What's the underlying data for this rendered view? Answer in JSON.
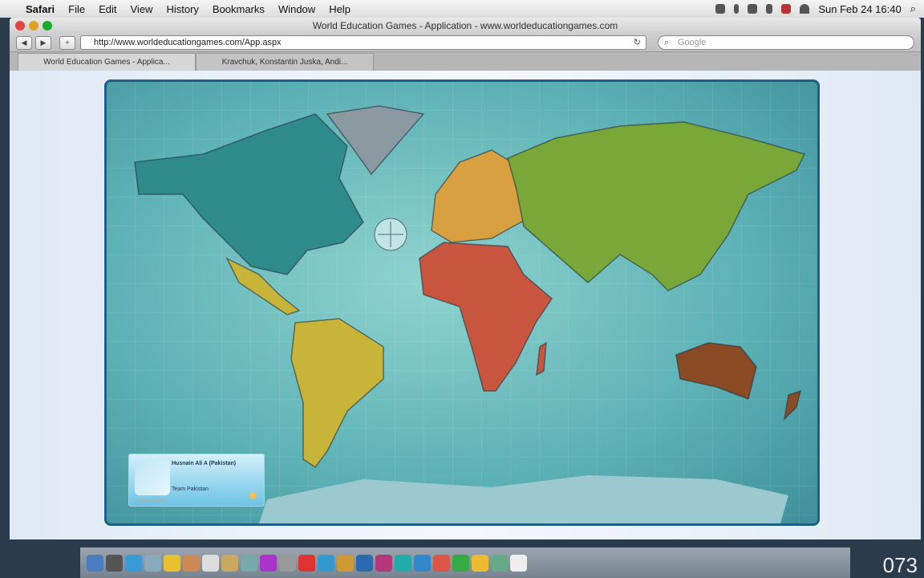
{
  "menubar": {
    "app": "Safari",
    "items": [
      "File",
      "Edit",
      "View",
      "History",
      "Bookmarks",
      "Window",
      "Help"
    ],
    "clock": "Sun Feb 24  16:40"
  },
  "window": {
    "title": "World Education Games - Application - www.worldeducationgames.com"
  },
  "toolbar": {
    "url": "http://www.worldeducationgames.com/App.aspx",
    "search_placeholder": "Google",
    "back": "◀",
    "forward": "▶",
    "add": "+",
    "reload": "↻"
  },
  "tabs": [
    {
      "label": "World Education Games - Applica..."
    },
    {
      "label": "Kravchuk, Konstantin Juska, Andi..."
    }
  ],
  "player": {
    "name": "Husnain Ali A (Pakistan)",
    "team": "Team Pakistan"
  },
  "colors": {
    "ocean": "#5bb0b4",
    "north_america": "#2f8a8a",
    "south_america": "#c9b43a",
    "europe": "#d8a040",
    "africa": "#c8553e",
    "asia": "#7aa838",
    "australia": "#8a4a24",
    "greenland": "#8a9aa0",
    "border": "#1f5e86"
  },
  "corner_text": "073"
}
